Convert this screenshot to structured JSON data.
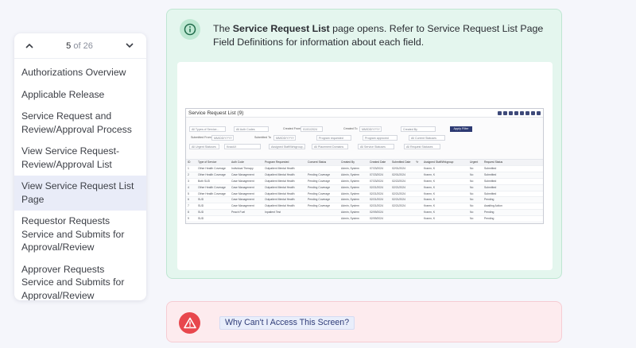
{
  "nav": {
    "counter_current": "5",
    "counter_text": "of 26",
    "items": [
      {
        "label": "Authorizations Overview"
      },
      {
        "label": "Applicable Release"
      },
      {
        "label": "Service Request and Review/Approval Process"
      },
      {
        "label": "View Service Request-Review/Approval List"
      },
      {
        "label": "View Service Request List Page",
        "active": true
      },
      {
        "label": "Requestor Requests Service and Submits for Approval/Review"
      },
      {
        "label": "Approver Requests Service and Submits for Approval/Review"
      }
    ]
  },
  "info": {
    "text_before": "The ",
    "bold": "Service Request List",
    "text_after": " page opens. Refer to Service Request List Page Field Definitions for information about each field.",
    "icon": "info-icon",
    "accent": "#e4f6ee"
  },
  "app": {
    "title": "Service Request List (9)",
    "filters": {
      "type_of_service": "All Types of Service...",
      "auth_codes": "All Auth Codes",
      "created_from": "Created From",
      "created_from_value": "01/01/2024",
      "created_to": "Created To",
      "created_to_value": "MM/DD/YYYY",
      "created_by": "Created By",
      "submitted_from": "Submitted From",
      "submitted_from_value": "MM/DD/YYYY",
      "submitted_to": "Submitted To",
      "submitted_to_value": "MM/DD/YYYY",
      "program_requested": "Program requested",
      "program_approved": "Program approved",
      "current_statuses": "All Current Statuses",
      "urgent": "All Urgent Statuses",
      "knack": "KnackX",
      "assigned_staff": "Assigned Staff/Wrkgroup...",
      "placement": "All Placement Domains",
      "service_statuses": "All Service Statuses",
      "request_statuses": "All Request Statuses",
      "apply": "Apply Filter"
    },
    "columns": [
      "ID",
      "Type of Service",
      "Auth Code",
      "Program Requested",
      "Consent Status",
      "Created By",
      "Created Date",
      "Submitted Date",
      "Yr",
      "Assigned Staff/Wrkgroup",
      "Urgent",
      "Request Status"
    ],
    "rows": [
      [
        "1",
        "Other Health Coverage",
        "Individual Therapy",
        "Outpatient Mental Health",
        "",
        "Admin, System",
        "07/23/2024",
        "02/01/2024",
        "",
        "Kramn, K",
        "No",
        "Submitted"
      ],
      [
        "2",
        "Other Health Coverage",
        "Case Management",
        "Outpatient Mental Health",
        "Pending Coverage",
        "Admin, System",
        "07/23/2024",
        "02/01/2024",
        "",
        "Kramn, K",
        "No",
        "Submitted"
      ],
      [
        "3",
        "Both SUD",
        "Case Management",
        "Outpatient Mental Health",
        "Pending Coverage",
        "Admin, System",
        "07/23/2024",
        "02/22/2024",
        "",
        "Kramn, K",
        "No",
        "Submitted"
      ],
      [
        "4",
        "Other Health Coverage",
        "Case Management",
        "Outpatient Mental Health",
        "Pending Coverage",
        "Admin, System",
        "02/21/2024",
        "02/21/2024",
        "",
        "Kramn, K",
        "No",
        "Submitted"
      ],
      [
        "5",
        "Other Health Coverage",
        "Case Management",
        "Outpatient Mental Health",
        "Pending Coverage",
        "Admin, System",
        "02/21/2024",
        "02/21/2024",
        "",
        "Kramn, K",
        "No",
        "Submitted"
      ],
      [
        "6",
        "SUD",
        "Case Management",
        "Outpatient Mental Health",
        "Pending Coverage",
        "Admin, System",
        "02/21/2024",
        "02/21/2024",
        "",
        "Kramn, K",
        "No",
        "Pending"
      ],
      [
        "7",
        "SUD",
        "Case Management",
        "Outpatient Mental Health",
        "Pending Coverage",
        "Admin, System",
        "02/21/2024",
        "02/21/2024",
        "",
        "Kramn, K",
        "No",
        "Awaiting Action"
      ],
      [
        "8",
        "SUD",
        "Peach Fuel",
        "Inpatient Test",
        "",
        "Admin, System",
        "02/09/2024",
        "",
        "",
        "Kramn, K",
        "No",
        "Pending"
      ],
      [
        "9",
        "SUD",
        "",
        "",
        "",
        "Admin, System",
        "02/09/2024",
        "",
        "",
        "Kramn, K",
        "No",
        "Pending"
      ]
    ]
  },
  "warning": {
    "link_label": "Why Can't I Access This Screen?",
    "icon": "warning-icon",
    "accent": "#e8474d"
  }
}
